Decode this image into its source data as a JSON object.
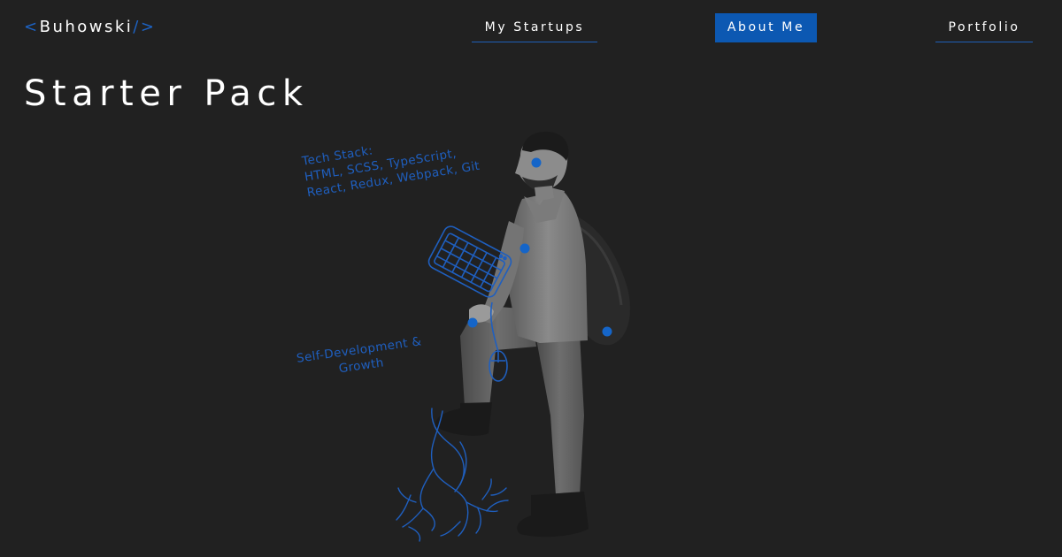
{
  "header": {
    "logo": {
      "open_bracket": "<",
      "name": "Buhowski",
      "close_bracket": "/>"
    },
    "nav": [
      {
        "label": "My Startups",
        "style": "underlined"
      },
      {
        "label": "About Me",
        "style": "active"
      },
      {
        "label": "Portfolio",
        "style": "underlined"
      }
    ]
  },
  "main": {
    "title": "Starter Pack",
    "annotations": {
      "tech_stack": {
        "lines": [
          "Tech Stack:",
          "HTML, SCSS, TypeScript,",
          "React, Redux, Webpack, Git"
        ]
      },
      "growth": {
        "lines": [
          "Self-Development &",
          "Growth"
        ]
      }
    }
  },
  "colors": {
    "background": "#212121",
    "accent": "#0c58b2",
    "sketch": "#1f5fbf",
    "text": "#ffffff"
  },
  "icons": [
    "keyboard-icon",
    "mouse-icon",
    "roots-icon",
    "hotspot-dot-icon"
  ]
}
